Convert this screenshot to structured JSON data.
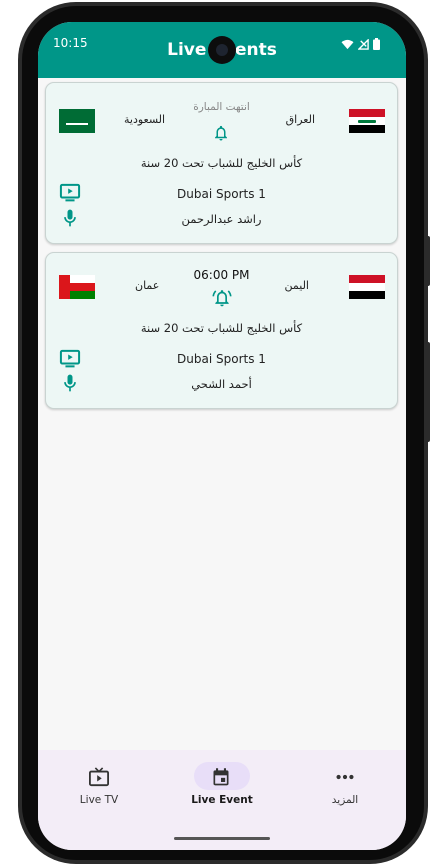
{
  "status_bar": {
    "time": "10:15"
  },
  "app_bar": {
    "title": "Live Events"
  },
  "matches": [
    {
      "home_team": "العراق",
      "away_team": "السعودية",
      "status": "انتهت المبارة",
      "league": "كأس الخليج للشباب تحت 20 سنة",
      "channel": "Dubai Sports 1",
      "commentator": "راشد عبدالرحمن",
      "home_flag": "iraq-flag",
      "away_flag": "saudi-flag"
    },
    {
      "home_team": "اليمن",
      "away_team": "عمان",
      "status": "06:00 PM",
      "league": "كأس الخليج للشباب تحت 20 سنة",
      "channel": "Dubai Sports 1",
      "commentator": "أحمد الشحي",
      "home_flag": "yemen-flag",
      "away_flag": "oman-flag"
    }
  ],
  "bottom_nav": {
    "items": [
      {
        "label": "Live TV",
        "icon": "live-tv-icon"
      },
      {
        "label": "Live Event",
        "icon": "calendar-icon",
        "active": true
      },
      {
        "label": "المزيد",
        "icon": "more-horizontal-icon"
      }
    ]
  },
  "colors": {
    "primary": "#009688",
    "card_bg": "#edf7f5",
    "nav_bg": "#f3edf7",
    "active_pill": "#e8def8"
  }
}
